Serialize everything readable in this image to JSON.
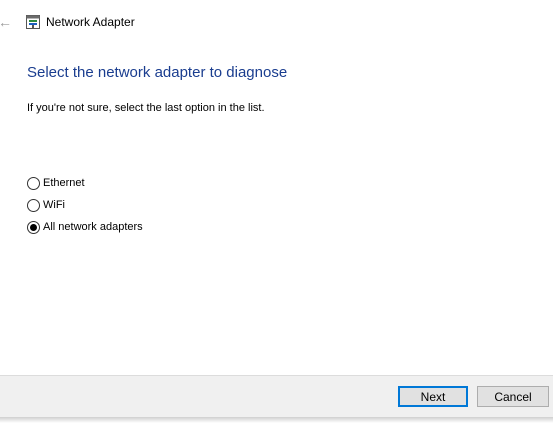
{
  "titlebar": {
    "title": "Network Adapter",
    "back_icon": "back-arrow-icon",
    "app_icon": "network-adapter-icon"
  },
  "main": {
    "heading": "Select the network adapter to diagnose",
    "hint": "If you're not sure, select the last option in the list.",
    "options": [
      {
        "label": "Ethernet",
        "checked": false
      },
      {
        "label": "WiFi",
        "checked": false
      },
      {
        "label": "All network adapters",
        "checked": true
      }
    ]
  },
  "footer": {
    "next_label": "Next",
    "cancel_label": "Cancel"
  },
  "colors": {
    "heading": "#1a3d8f",
    "default_button_border": "#0078d7",
    "footer_bg": "#f0f0f0"
  }
}
